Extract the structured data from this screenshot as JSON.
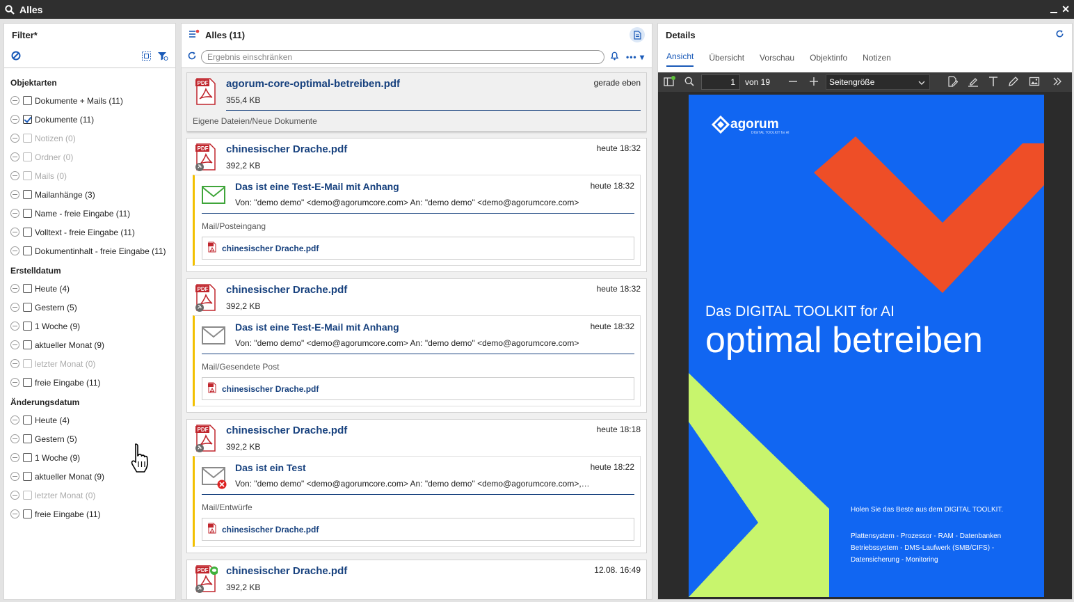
{
  "window": {
    "title": "Alles"
  },
  "filter": {
    "title": "Filter*",
    "sections": [
      {
        "title": "Objektarten",
        "items": [
          {
            "label": "Dokumente + Mails (11)",
            "checked": false,
            "disabled": false
          },
          {
            "label": "Dokumente (11)",
            "checked": true,
            "disabled": false
          },
          {
            "label": "Notizen (0)",
            "checked": false,
            "disabled": true
          },
          {
            "label": "Ordner (0)",
            "checked": false,
            "disabled": true
          },
          {
            "label": "Mails (0)",
            "checked": false,
            "disabled": true
          },
          {
            "label": "Mailanhänge (3)",
            "checked": false,
            "disabled": false
          },
          {
            "label": "Name - freie Eingabe (11)",
            "checked": false,
            "disabled": false
          },
          {
            "label": "Volltext - freie Eingabe (11)",
            "checked": false,
            "disabled": false
          },
          {
            "label": "Dokumentinhalt - freie Eingabe (11)",
            "checked": false,
            "disabled": false
          }
        ]
      },
      {
        "title": "Erstelldatum",
        "items": [
          {
            "label": "Heute (4)",
            "checked": false,
            "disabled": false
          },
          {
            "label": "Gestern (5)",
            "checked": false,
            "disabled": false
          },
          {
            "label": "1 Woche (9)",
            "checked": false,
            "disabled": false
          },
          {
            "label": "aktueller Monat (9)",
            "checked": false,
            "disabled": false
          },
          {
            "label": "letzter Monat (0)",
            "checked": false,
            "disabled": true
          },
          {
            "label": "freie Eingabe (11)",
            "checked": false,
            "disabled": false
          }
        ]
      },
      {
        "title": "Änderungsdatum",
        "items": [
          {
            "label": "Heute (4)",
            "checked": false,
            "disabled": false
          },
          {
            "label": "Gestern (5)",
            "checked": false,
            "disabled": false
          },
          {
            "label": "1 Woche (9)",
            "checked": false,
            "disabled": false
          },
          {
            "label": "aktueller Monat (9)",
            "checked": false,
            "disabled": false
          },
          {
            "label": "letzter Monat (0)",
            "checked": false,
            "disabled": true
          },
          {
            "label": "freie Eingabe (11)",
            "checked": false,
            "disabled": false
          }
        ]
      }
    ]
  },
  "list": {
    "title": "Alles (11)",
    "search_placeholder": "Ergebnis einschränken",
    "more_label": "•••",
    "cards": [
      {
        "name": "agorum-core-optimal-betreiben.pdf",
        "size": "355,4 KB",
        "time": "gerade eben",
        "path_a": "Eigene Dateien",
        "path_b": "Neue Dokumente",
        "selected": true
      },
      {
        "name": "chinesischer Drache.pdf",
        "size": "392,2 KB",
        "time": "heute 18:32",
        "link": true,
        "mail": {
          "subject": "Das ist eine Test-E-Mail mit Anhang",
          "time": "heute 18:32",
          "fromto": "Von: \"demo demo\" <demo@agorumcore.com>   An: \"demo demo\" <demo@agorumcore.com>",
          "path_a": "Mail",
          "path_b": "Posteingang",
          "attachment": "chinesischer Drache.pdf",
          "icon": "green"
        }
      },
      {
        "name": "chinesischer Drache.pdf",
        "size": "392,2 KB",
        "time": "heute 18:32",
        "link": true,
        "mail": {
          "subject": "Das ist eine Test-E-Mail mit Anhang",
          "time": "heute 18:32",
          "fromto": "Von: \"demo demo\" <demo@agorumcore.com>   An: \"demo demo\" <demo@agorumcore.com>",
          "path_a": "Mail",
          "path_b": "Gesendete Post",
          "attachment": "chinesischer Drache.pdf",
          "icon": "grey"
        }
      },
      {
        "name": "chinesischer Drache.pdf",
        "size": "392,2 KB",
        "time": "heute 18:18",
        "link": true,
        "mail": {
          "subject": "Das ist ein Test",
          "time": "heute 18:22",
          "fromto": "Von: \"demo demo\" <demo@agorumcore.com>   An: \"demo demo\" <demo@agorumcore.com>, info@exa…",
          "path_a": "Mail",
          "path_b": "Entwürfe",
          "attachment": "chinesischer Drache.pdf",
          "icon": "draft"
        }
      },
      {
        "name": "chinesischer Drache.pdf",
        "size": "392,2 KB",
        "time": "12.08. 16:49",
        "link": true,
        "comment": true
      }
    ]
  },
  "details": {
    "title": "Details",
    "tabs": [
      "Ansicht",
      "Übersicht",
      "Vorschau",
      "Objektinfo",
      "Notizen"
    ],
    "active_tab": 0,
    "viewer": {
      "page": "1",
      "of": "von 19",
      "zoom": "Seitengröße",
      "doc": {
        "brand": "agorum",
        "brand_sub": "DIGITAL TOOLKIT for AI",
        "subtitle": "Das DIGITAL TOOLKIT for AI",
        "title": "optimal betreiben",
        "line1": "Holen Sie das Beste aus dem DIGITAL TOOLKIT.",
        "line2": "Plattensystem - Prozessor - RAM - Datenbanken Betriebssystem - DMS-Laufwerk (SMB/CIFS) - Datensicherung - Monitoring"
      }
    }
  },
  "colors": {
    "link": "#17417e",
    "accent": "#1a5ab8",
    "mail_bar": "#f2c000",
    "doc_blue": "#1166f2",
    "doc_orange": "#ee4e27",
    "doc_green": "#c8f56d"
  }
}
